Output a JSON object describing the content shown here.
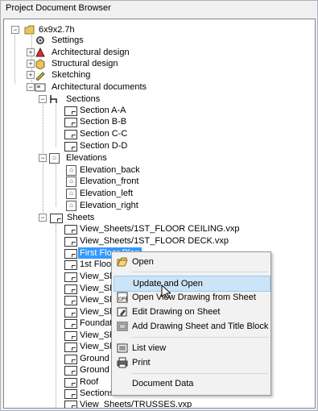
{
  "window": {
    "title": "Project Document Browser"
  },
  "tree": {
    "root": "6x9x2.7h",
    "items": {
      "settings": "Settings",
      "arch_design": "Architectural design",
      "struct_design": "Structural design",
      "sketching": "Sketching",
      "arch_docs": "Architectural documents",
      "sections": "Sections",
      "section_a": "Section A-A",
      "section_b": "Section B-B",
      "section_c": "Section C-C",
      "section_d": "Section D-D",
      "elevations": "Elevations",
      "elev_back": "Elevation_back",
      "elev_front": "Elevation_front",
      "elev_left": "Elevation_left",
      "elev_right": "Elevation_right",
      "sheets": "Sheets",
      "sheet1": "View_Sheets/1ST_FLOOR CEILING.vxp",
      "sheet2": "View_Sheets/1ST_FLOOR DECK.vxp",
      "sheet3": "First Floor Plan",
      "sheet4": "1st Floor",
      "sheet5": "View_Shee",
      "sheet6": "View_Shee",
      "sheet7": "View_Shee",
      "sheet8": "View_Shee",
      "sheet9": "Foundatio",
      "sheet10": "View_Shee",
      "sheet11": "View_Shee",
      "sheet12": "Ground F",
      "sheet13": "Ground F",
      "sheet14": "Roof",
      "sheet15": "Sections",
      "sheet16": "View_Sheets/TRUSSES.vxp"
    }
  },
  "context_menu": {
    "open": "Open",
    "update_open": "Update and Open",
    "open_view": "Open View Drawing from Sheet",
    "edit_drawing": "Edit Drawing on Sheet",
    "add_sheet": "Add Drawing Sheet and Title Block",
    "list_view": "List view",
    "print": "Print",
    "document_data": "Document Data"
  },
  "colors": {
    "selection": "#3399ff",
    "menu_highlight": "#cce4f7"
  }
}
